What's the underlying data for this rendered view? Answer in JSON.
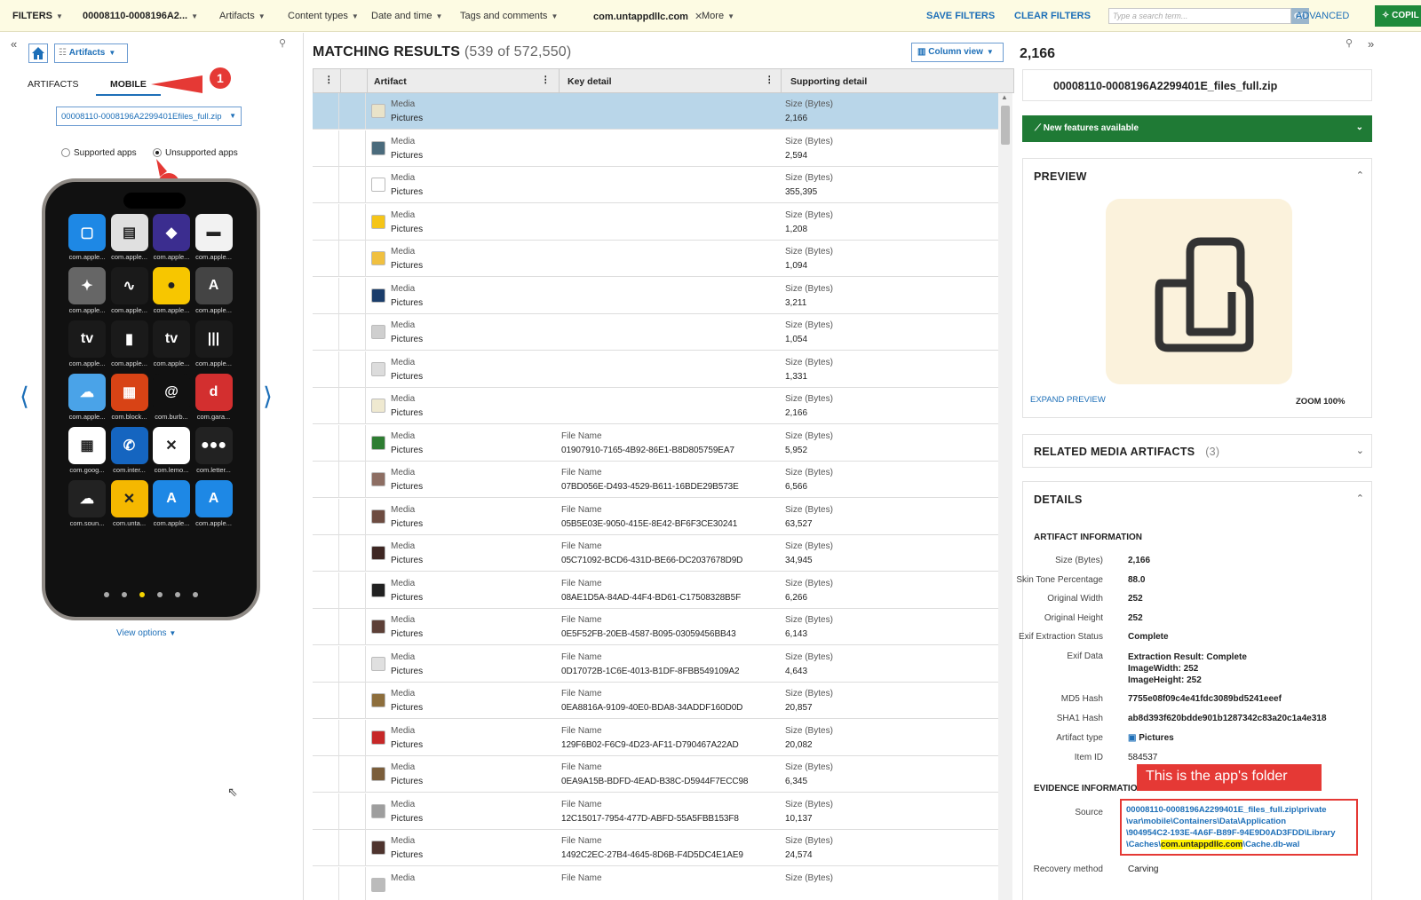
{
  "topbar": {
    "filters": "FILTERS",
    "case_name": "00008110-0008196A2...",
    "artifacts": "Artifacts",
    "content_types": "Content types",
    "date_time": "Date and time",
    "tags_comments": "Tags and comments",
    "active_filter": "com.untappdllc.com",
    "more": "More",
    "save_filters": "SAVE FILTERS",
    "clear_filters": "CLEAR FILTERS",
    "search_placeholder": "Type a search term...",
    "go": "GO",
    "advanced": "ADVANCED",
    "copilot": "COPIL"
  },
  "left": {
    "artifacts_dropdown": "Artifacts",
    "tabs": [
      "ARTIFACTS",
      "MOBILE"
    ],
    "source_dropdown": "00008110-0008196A2299401Efiles_full.zip",
    "radio_supported": "Supported apps",
    "radio_unsupported": "Unsupported apps",
    "view_options": "View options",
    "callout1": "1",
    "callout2": "2",
    "apps": [
      {
        "label": "com.apple...",
        "glyph": "▢",
        "color": "#1e88e5"
      },
      {
        "label": "com.apple...",
        "glyph": "▤",
        "color": "#e0e0e0"
      },
      {
        "label": "com.apple...",
        "glyph": "◆",
        "color": "#3b2d8f"
      },
      {
        "label": "com.apple...",
        "glyph": "▬",
        "color": "#f2f2f2"
      },
      {
        "label": "com.apple...",
        "glyph": "✦",
        "color": "#666"
      },
      {
        "label": "com.apple...",
        "glyph": "∿",
        "color": "#1a1a1a"
      },
      {
        "label": "com.apple...",
        "glyph": "●",
        "color": "#f7c600"
      },
      {
        "label": "com.apple...",
        "glyph": "A",
        "color": "#444"
      },
      {
        "label": "com.apple...",
        "glyph": "tv",
        "color": "#1a1a1a"
      },
      {
        "label": "com.apple...",
        "glyph": "▮",
        "color": "#1a1a1a"
      },
      {
        "label": "com.apple...",
        "glyph": "tv",
        "color": "#1a1a1a"
      },
      {
        "label": "com.apple...",
        "glyph": "|||",
        "color": "#1a1a1a"
      },
      {
        "label": "com.apple...",
        "glyph": "☁",
        "color": "#4aa3e8"
      },
      {
        "label": "com.block...",
        "glyph": "▦",
        "color": "#d84315"
      },
      {
        "label": "com.burb...",
        "glyph": "@",
        "color": "#111"
      },
      {
        "label": "com.gara...",
        "glyph": "d",
        "color": "#d32f2f"
      },
      {
        "label": "com.goog...",
        "glyph": "▦",
        "color": "#fff"
      },
      {
        "label": "com.inter...",
        "glyph": "✆",
        "color": "#1565c0"
      },
      {
        "label": "com.lemo...",
        "glyph": "✕",
        "color": "#fff"
      },
      {
        "label": "com.letter...",
        "glyph": "●●●",
        "color": "#222"
      },
      {
        "label": "com.soun...",
        "glyph": "☁",
        "color": "#222"
      },
      {
        "label": "com.unta...",
        "glyph": "✕",
        "color": "#f5b800"
      },
      {
        "label": "com.apple...",
        "glyph": "A",
        "color": "#1e88e5"
      },
      {
        "label": "com.apple...",
        "glyph": "A",
        "color": "#1e88e5"
      }
    ]
  },
  "middle": {
    "title": "MATCHING RESULTS",
    "count": "(539 of 572,550)",
    "column_view": "Column view",
    "headers": {
      "artifact": "Artifact",
      "key_detail": "Key detail",
      "supporting_detail": "Supporting detail"
    },
    "rows": [
      {
        "a1": "Media",
        "a2": "Pictures",
        "k1": "",
        "k2": "",
        "s1": "Size (Bytes)",
        "s2": "2,166",
        "sel": true,
        "tcol": "#e9e3c9"
      },
      {
        "a1": "Media",
        "a2": "Pictures",
        "k1": "",
        "k2": "",
        "s1": "Size (Bytes)",
        "s2": "2,594",
        "tcol": "#4b6b7c"
      },
      {
        "a1": "Media",
        "a2": "Pictures",
        "k1": "",
        "k2": "",
        "s1": "Size (Bytes)",
        "s2": "355,395",
        "tcol": "#ffffff"
      },
      {
        "a1": "Media",
        "a2": "Pictures",
        "k1": "",
        "k2": "",
        "s1": "Size (Bytes)",
        "s2": "1,208",
        "tcol": "#f5c518"
      },
      {
        "a1": "Media",
        "a2": "Pictures",
        "k1": "",
        "k2": "",
        "s1": "Size (Bytes)",
        "s2": "1,094",
        "tcol": "#f0c040"
      },
      {
        "a1": "Media",
        "a2": "Pictures",
        "k1": "",
        "k2": "",
        "s1": "Size (Bytes)",
        "s2": "3,211",
        "tcol": "#1b3d6b"
      },
      {
        "a1": "Media",
        "a2": "Pictures",
        "k1": "",
        "k2": "",
        "s1": "Size (Bytes)",
        "s2": "1,054",
        "tcol": "#cfcfcf"
      },
      {
        "a1": "Media",
        "a2": "Pictures",
        "k1": "",
        "k2": "",
        "s1": "Size (Bytes)",
        "s2": "1,331",
        "tcol": "#dcdcdc"
      },
      {
        "a1": "Media",
        "a2": "Pictures",
        "k1": "",
        "k2": "",
        "s1": "Size (Bytes)",
        "s2": "2,166",
        "tcol": "#efe9d0"
      },
      {
        "a1": "Media",
        "a2": "Pictures",
        "k1": "File Name",
        "k2": "01907910-7165-4B92-86E1-B8D805759EA7",
        "s1": "Size (Bytes)",
        "s2": "5,952",
        "tcol": "#2e7d32"
      },
      {
        "a1": "Media",
        "a2": "Pictures",
        "k1": "File Name",
        "k2": "07BD056E-D493-4529-B611-16BDE29B573E",
        "s1": "Size (Bytes)",
        "s2": "6,566",
        "tcol": "#8d6e63"
      },
      {
        "a1": "Media",
        "a2": "Pictures",
        "k1": "File Name",
        "k2": "05B5E03E-9050-415E-8E42-BF6F3CE30241",
        "s1": "Size (Bytes)",
        "s2": "63,527",
        "tcol": "#6d4c41"
      },
      {
        "a1": "Media",
        "a2": "Pictures",
        "k1": "File Name",
        "k2": "05C71092-BCD6-431D-BE66-DC2037678D9D",
        "s1": "Size (Bytes)",
        "s2": "34,945",
        "tcol": "#3e2723"
      },
      {
        "a1": "Media",
        "a2": "Pictures",
        "k1": "File Name",
        "k2": "08AE1D5A-84AD-44F4-BD61-C17508328B5F",
        "s1": "Size (Bytes)",
        "s2": "6,266",
        "tcol": "#212121"
      },
      {
        "a1": "Media",
        "a2": "Pictures",
        "k1": "File Name",
        "k2": "0E5F52FB-20EB-4587-B095-03059456BB43",
        "s1": "Size (Bytes)",
        "s2": "6,143",
        "tcol": "#5d4037"
      },
      {
        "a1": "Media",
        "a2": "Pictures",
        "k1": "File Name",
        "k2": "0D17072B-1C6E-4013-B1DF-8FBB549109A2",
        "s1": "Size (Bytes)",
        "s2": "4,643",
        "tcol": "#e0e0e0"
      },
      {
        "a1": "Media",
        "a2": "Pictures",
        "k1": "File Name",
        "k2": "0EA8816A-9109-40E0-BDA8-34ADDF160D0D",
        "s1": "Size (Bytes)",
        "s2": "20,857",
        "tcol": "#8d6e3c"
      },
      {
        "a1": "Media",
        "a2": "Pictures",
        "k1": "File Name",
        "k2": "129F6B02-F6C9-4D23-AF11-D790467A22AD",
        "s1": "Size (Bytes)",
        "s2": "20,082",
        "tcol": "#c62828"
      },
      {
        "a1": "Media",
        "a2": "Pictures",
        "k1": "File Name",
        "k2": "0EA9A15B-BDFD-4EAD-B38C-D5944F7ECC98",
        "s1": "Size (Bytes)",
        "s2": "6,345",
        "tcol": "#7b5e3b"
      },
      {
        "a1": "Media",
        "a2": "Pictures",
        "k1": "File Name",
        "k2": "12C15017-7954-477D-ABFD-55A5FBB153F8",
        "s1": "Size (Bytes)",
        "s2": "10,137",
        "tcol": "#9e9e9e"
      },
      {
        "a1": "Media",
        "a2": "Pictures",
        "k1": "File Name",
        "k2": "1492C2EC-27B4-4645-8D6B-F4D5DC4E1AE9",
        "s1": "Size (Bytes)",
        "s2": "24,574",
        "tcol": "#4e342e"
      },
      {
        "a1": "Media",
        "a2": "",
        "k1": "File Name",
        "k2": "",
        "s1": "Size (Bytes)",
        "s2": "",
        "tcol": "#bbbbbb"
      }
    ]
  },
  "right": {
    "size_title": "2,166",
    "file_name": "00008110-0008196A2299401E_files_full.zip",
    "new_features": "New features available",
    "preview": "PREVIEW",
    "expand_preview": "EXPAND PREVIEW",
    "zoom": "ZOOM 100%",
    "related": "RELATED MEDIA ARTIFACTS",
    "related_count": "(3)",
    "details": "DETAILS",
    "artifact_info": "ARTIFACT INFORMATION",
    "fields": [
      {
        "k": "Size (Bytes)",
        "v": "2,166"
      },
      {
        "k": "Skin Tone Percentage",
        "v": "88.0"
      },
      {
        "k": "Original Width",
        "v": "252"
      },
      {
        "k": "Original Height",
        "v": "252"
      },
      {
        "k": "Exif Extraction Status",
        "v": "Complete"
      }
    ],
    "exif_key": "Exif Data",
    "exif_lines": [
      "Extraction Result: Complete",
      "ImageWidth: 252",
      "ImageHeight: 252"
    ],
    "md5_key": "MD5 Hash",
    "md5": "7755e08f09c4e41fdc3089bd5241eeef",
    "sha1_key": "SHA1 Hash",
    "sha1": "ab8d393f620bdde901b1287342c83a20c1a4e318",
    "type_key": "Artifact type",
    "type_val": "Pictures",
    "id_key": "Item ID",
    "id_val": "584537",
    "evidence_info": "EVIDENCE INFORMATION",
    "source_key": "Source",
    "source_l1": "00008110-0008196A2299401E_files_full.zip\\private",
    "source_l2": "\\var\\mobile\\Containers\\Data\\Application",
    "source_l3": "\\904954C2-193E-4A6F-B89F-94E9D0AD3FDD\\Library",
    "source_l4a": "\\Caches\\",
    "source_l4b": "com.untappdllc.com",
    "source_l4c": "\\Cache.db-wal",
    "recovery_key": "Recovery method",
    "recovery_val": "Carving",
    "annotation": "This is the app's folder"
  },
  "colors": {
    "accent": "#1d6fb8",
    "green": "#1f7a35",
    "callout": "#e53935"
  }
}
